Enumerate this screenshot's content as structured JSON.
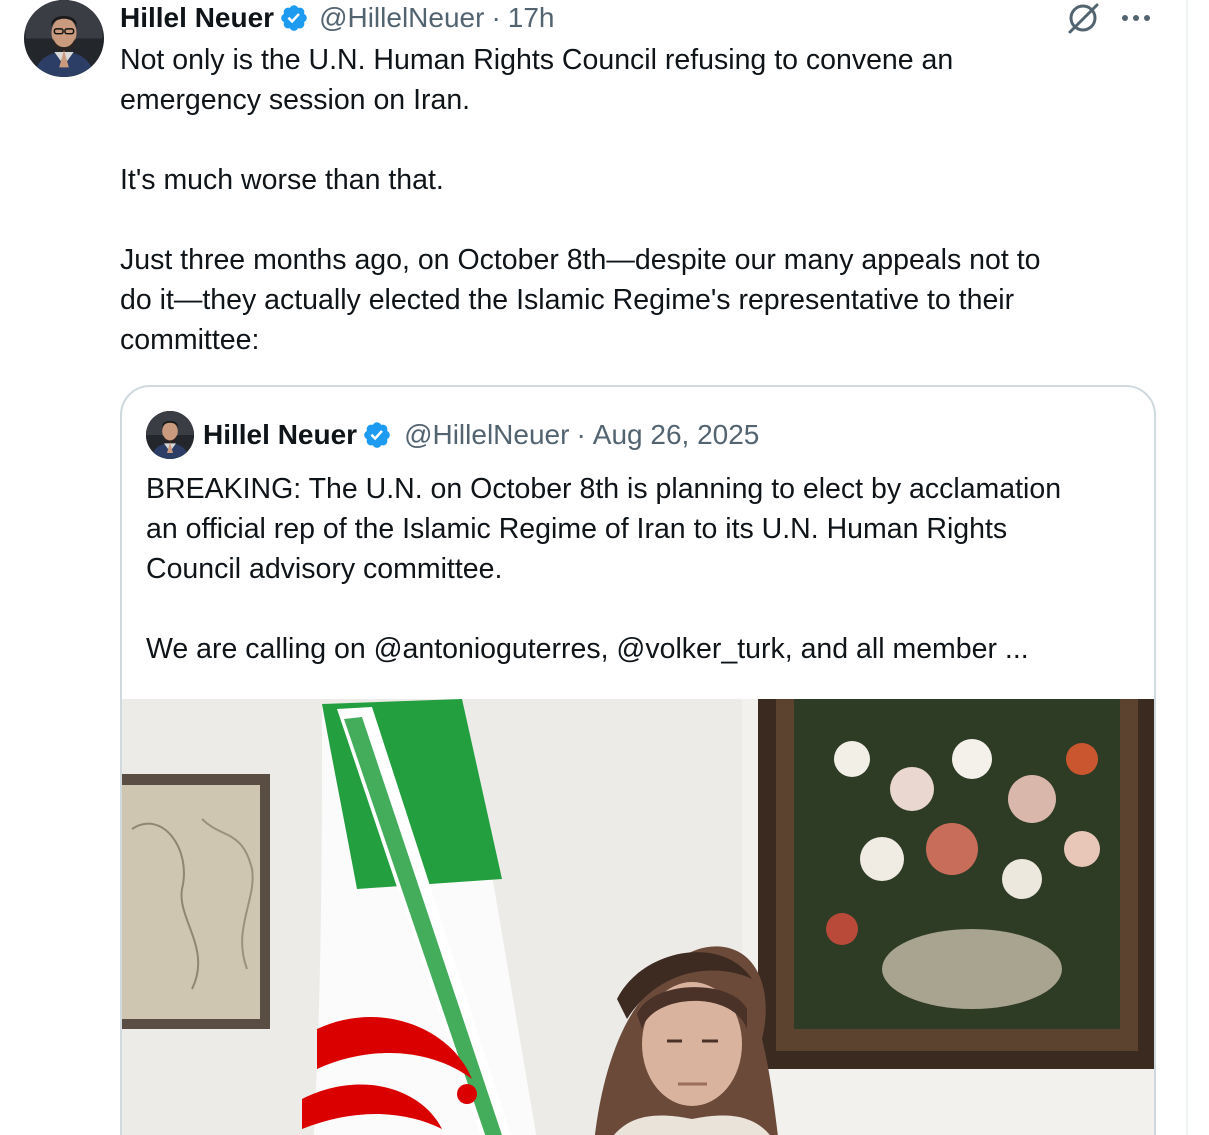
{
  "post": {
    "author_name": "Hillel Neuer",
    "handle": "@HillelNeuer",
    "separator": "·",
    "time": "17h",
    "text_lines": [
      "Not only is the U.N. Human Rights Council refusing to convene an",
      "emergency session on Iran.",
      "",
      "It's much worse than that.",
      "",
      "Just three months ago, on October 8th—despite our many appeals not to",
      "do it—they actually elected the Islamic Regime's representative to their",
      "committee:"
    ]
  },
  "quoted_post": {
    "author_name": "Hillel Neuer",
    "handle": "@HillelNeuer",
    "separator": "·",
    "date": "Aug 26, 2025",
    "text_lines": [
      "BREAKING: The U.N. on October 8th is planning to elect by acclamation",
      "an official rep of the Islamic Regime of Iran to its U.N. Human Rights",
      "Council advisory committee.",
      "",
      "We are calling on @antonioguterres, @volker_turk, and all member ..."
    ]
  },
  "icons": {
    "verified": "verified-badge-icon",
    "grok": "grok-icon",
    "more": "more-options-icon"
  },
  "colors": {
    "text": "#0f1419",
    "secondary": "#536471",
    "verified_blue": "#1d9bf0",
    "border": "#cfd9de",
    "flag_green": "#239f40",
    "flag_red": "#da0000"
  }
}
